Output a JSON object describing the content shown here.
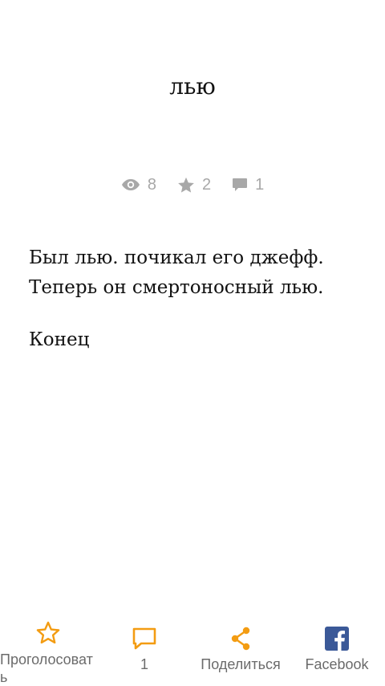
{
  "story": {
    "title": "лью",
    "stats": {
      "views": "8",
      "votes": "2",
      "comments": "1"
    },
    "paragraphs": [
      "Был лью. почикал его джефф. Теперь он смертоносный лью.",
      "Конец"
    ]
  },
  "bottom_bar": {
    "vote_label": "Проголосовать",
    "comments_count": "1",
    "share_label": "Поделиться",
    "facebook_label": "Facebook"
  },
  "colors": {
    "accent": "#f39c12",
    "stats_gray": "#a8a8a8",
    "facebook_blue": "#3b5998"
  }
}
